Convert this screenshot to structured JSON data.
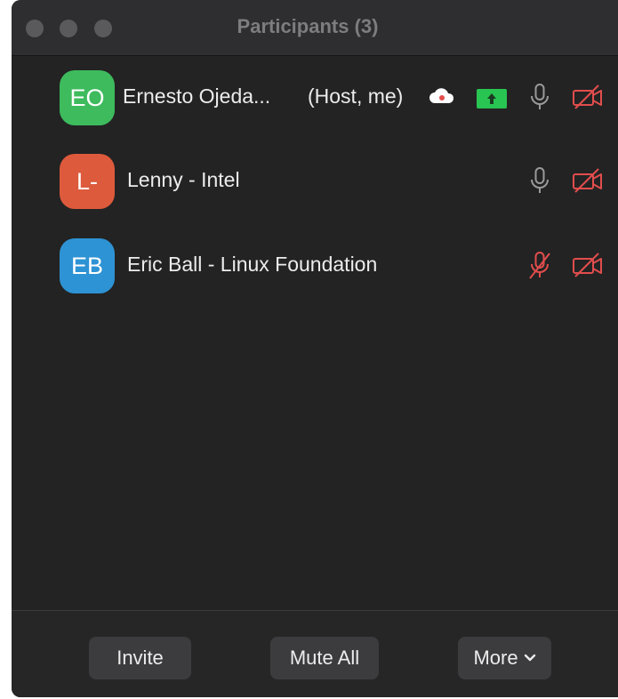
{
  "window": {
    "title": "Participants (3)"
  },
  "participants": [
    {
      "initials": "EO",
      "avatar_color": "#3dbb5d",
      "name": "Ernesto Ojeda...",
      "role": "(Host, me)",
      "recording_cloud": true,
      "sharing": true,
      "mic": "on",
      "video": "off"
    },
    {
      "initials": "L-",
      "avatar_color": "#dd5a3c",
      "name": "Lenny - Intel",
      "mic": "on",
      "video": "off"
    },
    {
      "initials": "EB",
      "avatar_color": "#2e93d4",
      "name": "Eric Ball - Linux Foundation",
      "mic": "muted",
      "video": "off"
    }
  ],
  "footer": {
    "invite_label": "Invite",
    "mute_all_label": "Mute All",
    "more_label": "More"
  },
  "colors": {
    "muted_red": "#e24d4d",
    "share_green": "#29c552",
    "mic_gray": "#9a9a9a",
    "background": "#232323"
  }
}
